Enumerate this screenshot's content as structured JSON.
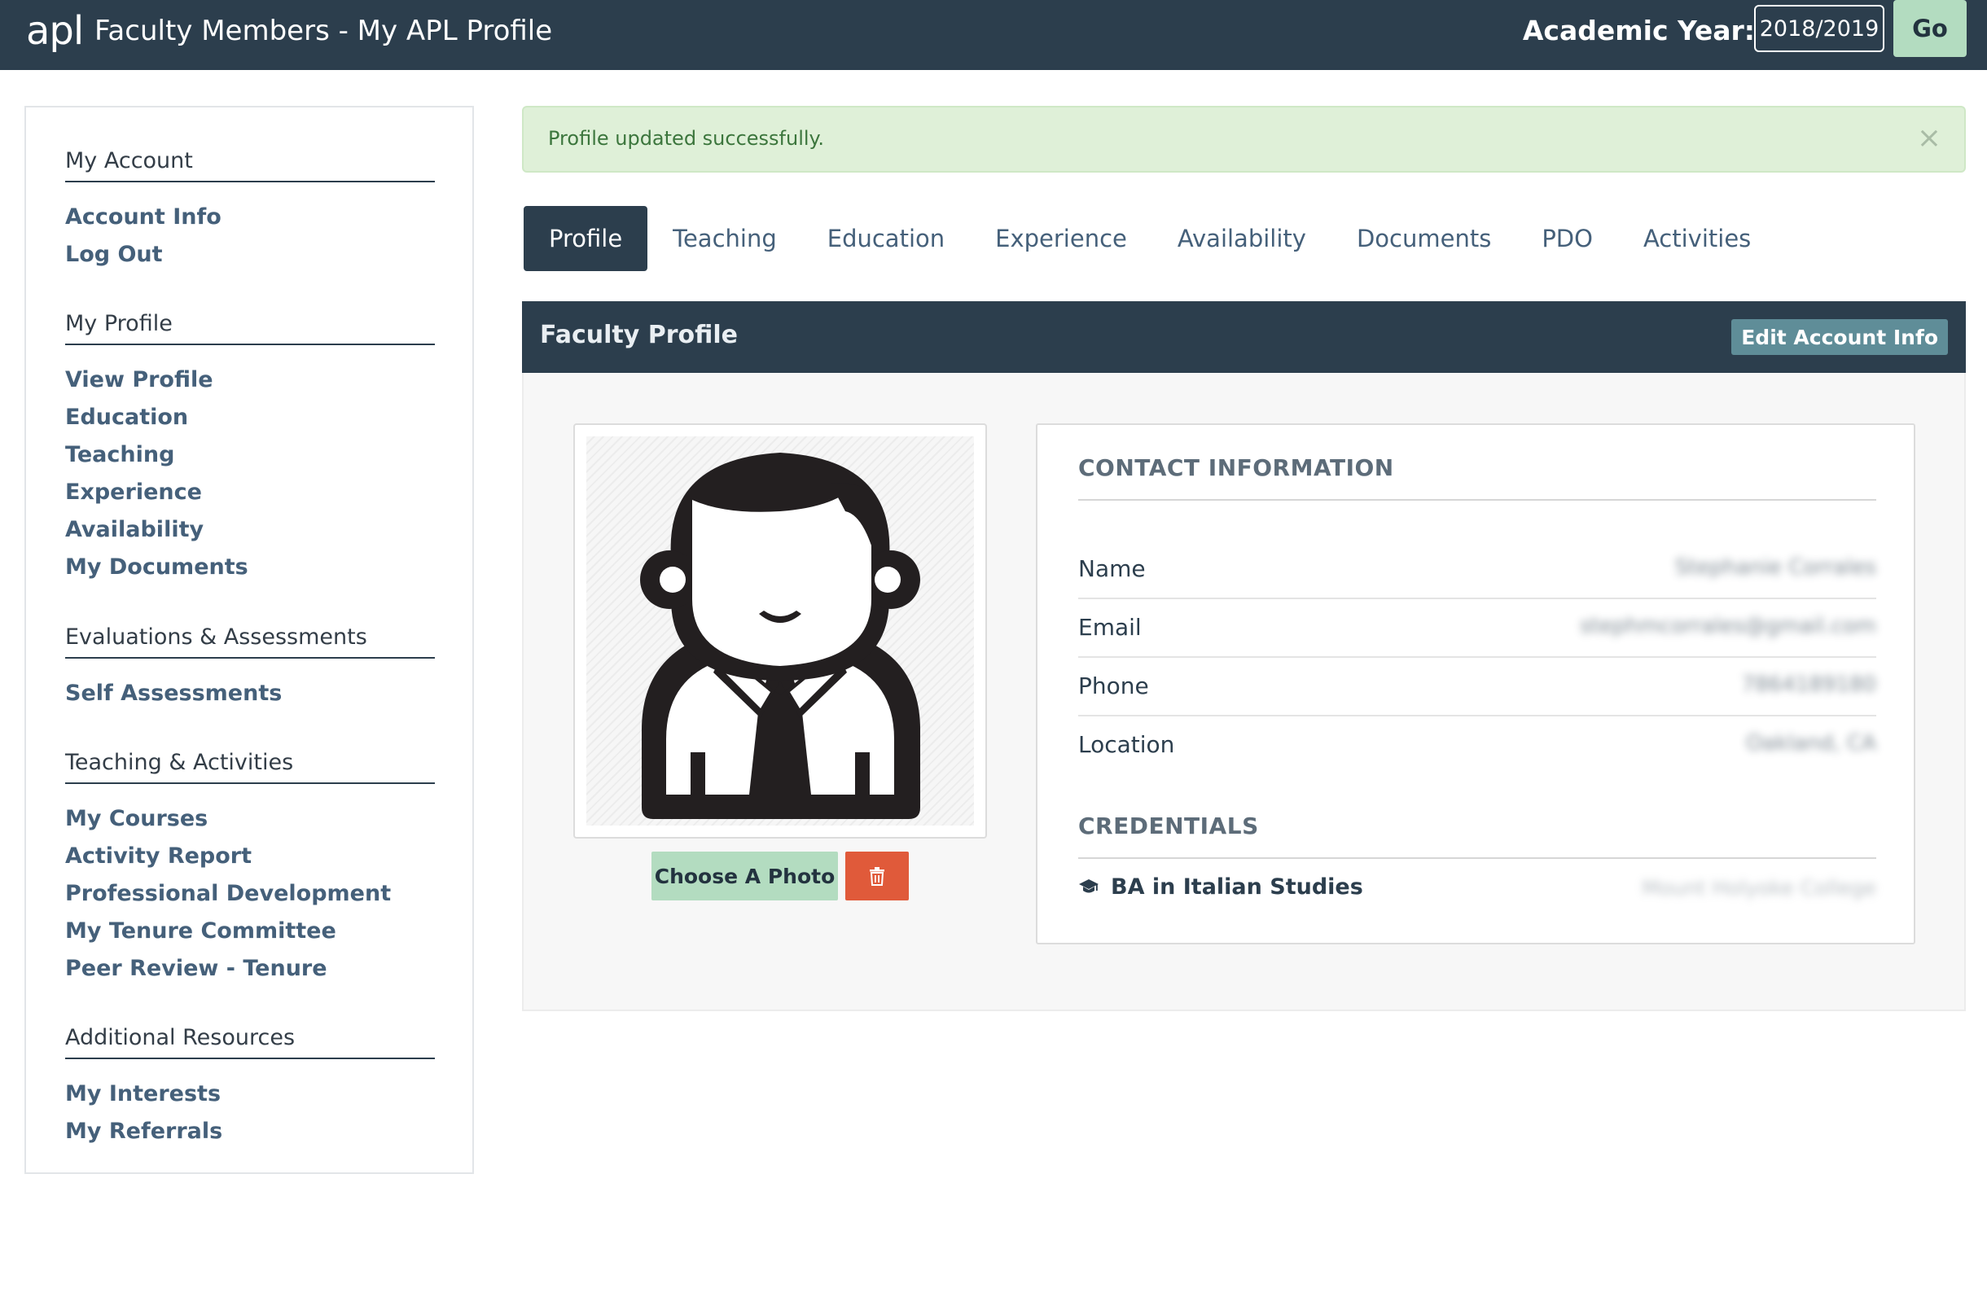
{
  "header": {
    "logo": "apl",
    "title": "Faculty Members - My APL Profile",
    "academic_year_label": "Academic Year:",
    "academic_year_value": "2018/2019",
    "go_label": "Go"
  },
  "sidebar": {
    "sections": [
      {
        "heading": "My Account",
        "links": [
          "Account Info",
          "Log Out"
        ]
      },
      {
        "heading": "My Profile",
        "links": [
          "View Profile",
          "Education",
          "Teaching",
          "Experience",
          "Availability",
          "My Documents"
        ]
      },
      {
        "heading": "Evaluations & Assessments",
        "links": [
          "Self Assessments"
        ]
      },
      {
        "heading": "Teaching & Activities",
        "links": [
          "My Courses",
          "Activity Report",
          "Professional Development",
          "My Tenure Committee",
          "Peer Review - Tenure"
        ]
      },
      {
        "heading": "Additional Resources",
        "links": [
          "My Interests",
          "My Referrals"
        ]
      }
    ]
  },
  "alert": {
    "message": "Profile updated successfully.",
    "close": "×"
  },
  "tabs": [
    "Profile",
    "Teaching",
    "Education",
    "Experience",
    "Availability",
    "Documents",
    "PDO",
    "Activities"
  ],
  "panel": {
    "title": "Faculty Profile",
    "edit_button": "Edit Account Info"
  },
  "photo": {
    "choose_button": "Choose A Photo",
    "avatar_icon": "person-avatar-icon",
    "delete_icon": "trash-icon"
  },
  "contact": {
    "heading": "CONTACT INFORMATION",
    "rows": [
      {
        "label": "Name",
        "value": "Stephanie Corrales"
      },
      {
        "label": "Email",
        "value": "stephmcorrales@gmail.com"
      },
      {
        "label": "Phone",
        "value": "7864189180"
      },
      {
        "label": "Location",
        "value": "Oakland, CA"
      }
    ]
  },
  "credentials": {
    "heading": "CREDENTIALS",
    "items": [
      {
        "degree": "BA in Italian Studies",
        "school": "Mount Holyoke College",
        "icon": "graduation-cap-icon"
      }
    ]
  },
  "colors": {
    "navy": "#2c3e4d",
    "link": "#45607a",
    "success_bg": "#dff0d8",
    "mint": "#b3dcc0",
    "danger": "#e05a3a",
    "teal": "#5f8d98"
  }
}
